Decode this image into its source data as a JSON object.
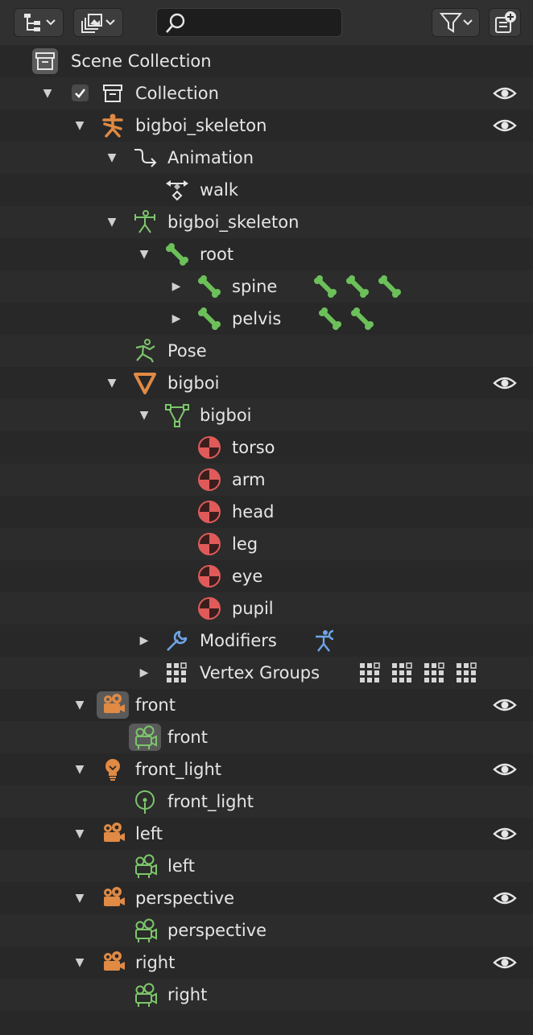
{
  "header": {
    "display_mode_icon": "outliner-display-mode-icon",
    "filter_icon": "funnel-icon",
    "new_collection_icon": "new-collection-icon",
    "search": {
      "value": "",
      "placeholder": ""
    }
  },
  "tree": {
    "scene_collection": "Scene Collection",
    "collection": "Collection",
    "skeleton_object": "bigboi_skeleton",
    "animation": "Animation",
    "action": "walk",
    "armature_data": "bigboi_skeleton",
    "root_bone": "root",
    "spine_bone": "spine",
    "pelvis_bone": "pelvis",
    "pose": "Pose",
    "mesh_object": "bigboi",
    "mesh_data": "bigboi",
    "materials": [
      "torso",
      "arm",
      "head",
      "leg",
      "eye",
      "pupil"
    ],
    "modifiers": "Modifiers",
    "vertex_groups": "Vertex Groups",
    "front_camera": "front",
    "front_camera_data": "front",
    "front_light": "front_light",
    "front_light_data": "front_light",
    "left_camera": "left",
    "left_camera_data": "left",
    "perspective_camera": "perspective",
    "perspective_camera_data": "perspective",
    "right_camera": "right",
    "right_camera_data": "right"
  },
  "colors": {
    "object_orange": "#e08a44",
    "data_green": "#7cc66b",
    "bone_green": "#6cc05a",
    "material_red": "#e05a5a",
    "modifier_blue": "#6fa5e6"
  }
}
